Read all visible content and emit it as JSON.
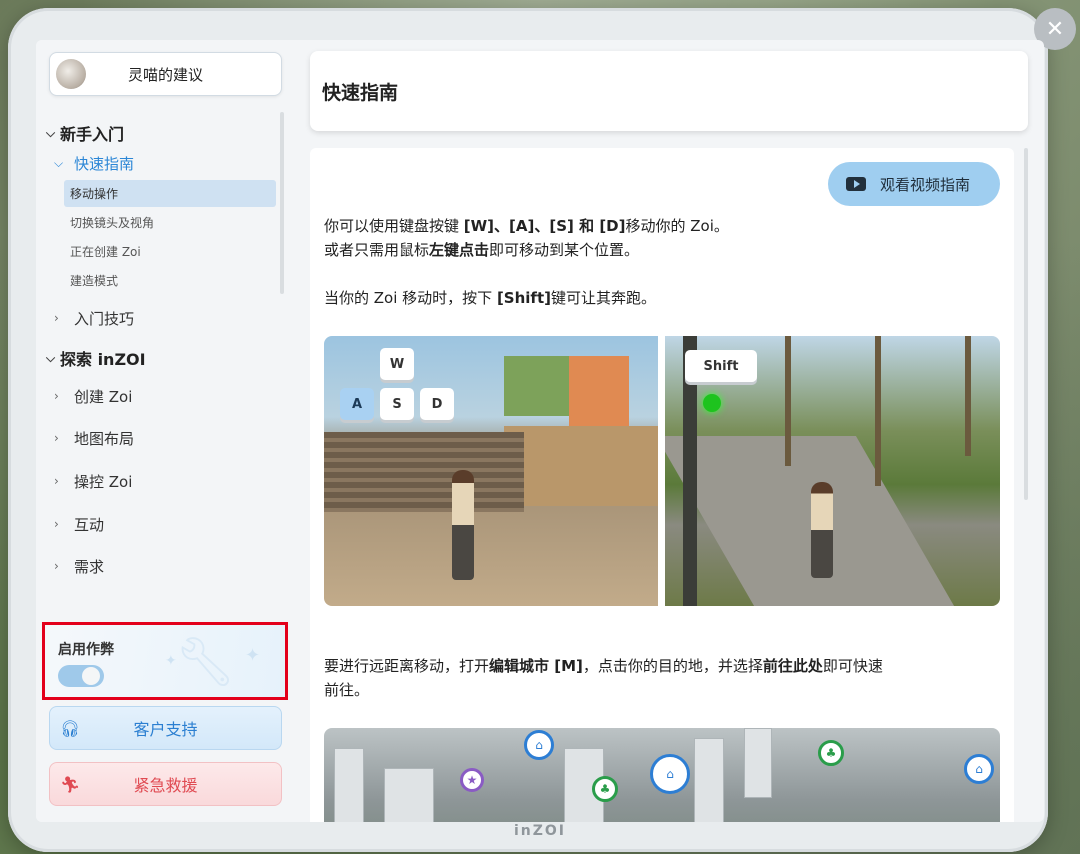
{
  "brand": "inZOI",
  "advisor": {
    "label": "灵喵的建议"
  },
  "nav": {
    "sections": [
      {
        "label": "新手入门",
        "expanded": true,
        "children": [
          {
            "label": "快速指南",
            "expanded": true,
            "active": true,
            "items": [
              "移动操作",
              "切换镜头及视角",
              "正在创建 Zoi",
              "建造模式"
            ]
          },
          {
            "label": "入门技巧",
            "expanded": false
          }
        ]
      },
      {
        "label": "探索 inZOI",
        "expanded": true,
        "children": [
          {
            "label": "创建 Zoi"
          },
          {
            "label": "地图布局"
          },
          {
            "label": "操控 Zoi"
          },
          {
            "label": "互动"
          },
          {
            "label": "需求"
          }
        ]
      }
    ],
    "selected_item": "移动操作"
  },
  "cheat": {
    "label": "启用作弊",
    "enabled": true
  },
  "buttons": {
    "support": "客户支持",
    "rescue": "紧急救援"
  },
  "header": {
    "title": "快速指南"
  },
  "content": {
    "video_button": "观看视频指南",
    "p1_a": "你可以使用键盘按键 ",
    "p1_keys": "[W]、[A]、[S] 和 [D]",
    "p1_b": "移动你的 Zoi。",
    "p2_a": "或者只需用鼠标",
    "p2_bold": "左键点击",
    "p2_b": "即可移动到某个位置。",
    "p3_a": "当你的 Zoi 移动时，按下 ",
    "p3_bold": "[Shift]",
    "p3_b": "键可让其奔跑。",
    "p4_a": "要进行远距离移动，打开",
    "p4_bold1": "编辑城市 [M]",
    "p4_b": "，点击你的目的地，并选择",
    "p4_bold2": "前往此处",
    "p4_c": "即可快速",
    "p4_d": "前往。",
    "keys": {
      "w": "W",
      "a": "A",
      "s": "S",
      "d": "D",
      "shift": "Shift"
    }
  },
  "colors": {
    "accent": "#2b86d6",
    "highlight_box": "#e3001b",
    "support": "#2b7fd1",
    "rescue": "#e04a52"
  },
  "icons": [
    "close-icon",
    "headset-icon",
    "running-person-icon",
    "video-play-icon",
    "wrench-icon",
    "chevron-down-icon",
    "chevron-right-icon"
  ]
}
